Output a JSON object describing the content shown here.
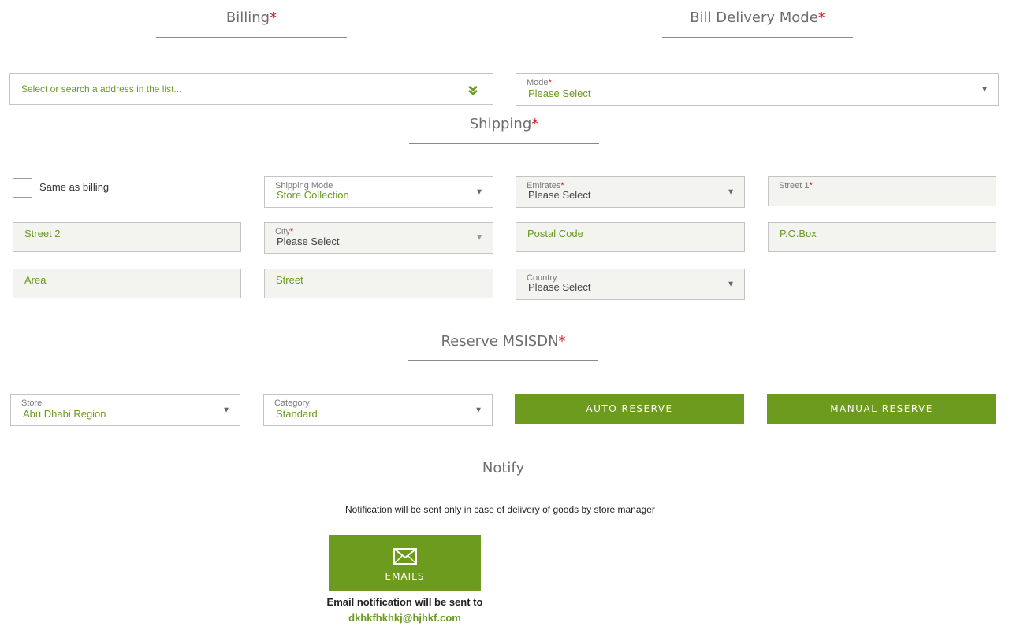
{
  "billing": {
    "title": "Billing",
    "required_mark": "*",
    "address_placeholder": "Select or search a address in the list..."
  },
  "bill_delivery": {
    "title": "Bill Delivery Mode",
    "required_mark": "*",
    "mode_label": "Mode",
    "mode_required": "*",
    "mode_value": "Please Select"
  },
  "shipping": {
    "title": "Shipping",
    "required_mark": "*",
    "same_as_billing_label": "Same as billing",
    "shipping_mode_label": "Shipping Mode",
    "shipping_mode_value": "Store Collection",
    "emirates_label": "Emirates",
    "emirates_required": "*",
    "emirates_value": "Please Select",
    "street1_label": "Street 1",
    "street1_required": "*",
    "street2_placeholder": "Street 2",
    "city_label": "City",
    "city_required": "*",
    "city_value": "Please Select",
    "postal_code_placeholder": "Postal Code",
    "pobox_placeholder": "P.O.Box",
    "area_placeholder": "Area",
    "street_placeholder": "Street",
    "country_label": "Country",
    "country_value": "Please Select"
  },
  "reserve": {
    "title": "Reserve MSISDN",
    "required_mark": "*",
    "store_label": "Store",
    "store_value": "Abu Dhabi Region",
    "category_label": "Category",
    "category_value": "Standard",
    "auto_reserve_label": "AUTO RESERVE",
    "manual_reserve_label": "MANUAL RESERVE"
  },
  "notify": {
    "title": "Notify",
    "notice": "Notification will be sent only in case of delivery of goods by store manager",
    "emails_label": "EMAILS",
    "email_sent_text": "Email notification will be sent to",
    "email_address": "dkhkfhkhkj@hjhkf.com"
  },
  "icons": {
    "dropdown_caret": "▼",
    "address_chevron": "double-chevron-down-icon",
    "email": "envelope-icon"
  },
  "colors": {
    "accent": "#6d9b1e",
    "value_text": "#6a9a1f",
    "required": "#d6161e"
  }
}
